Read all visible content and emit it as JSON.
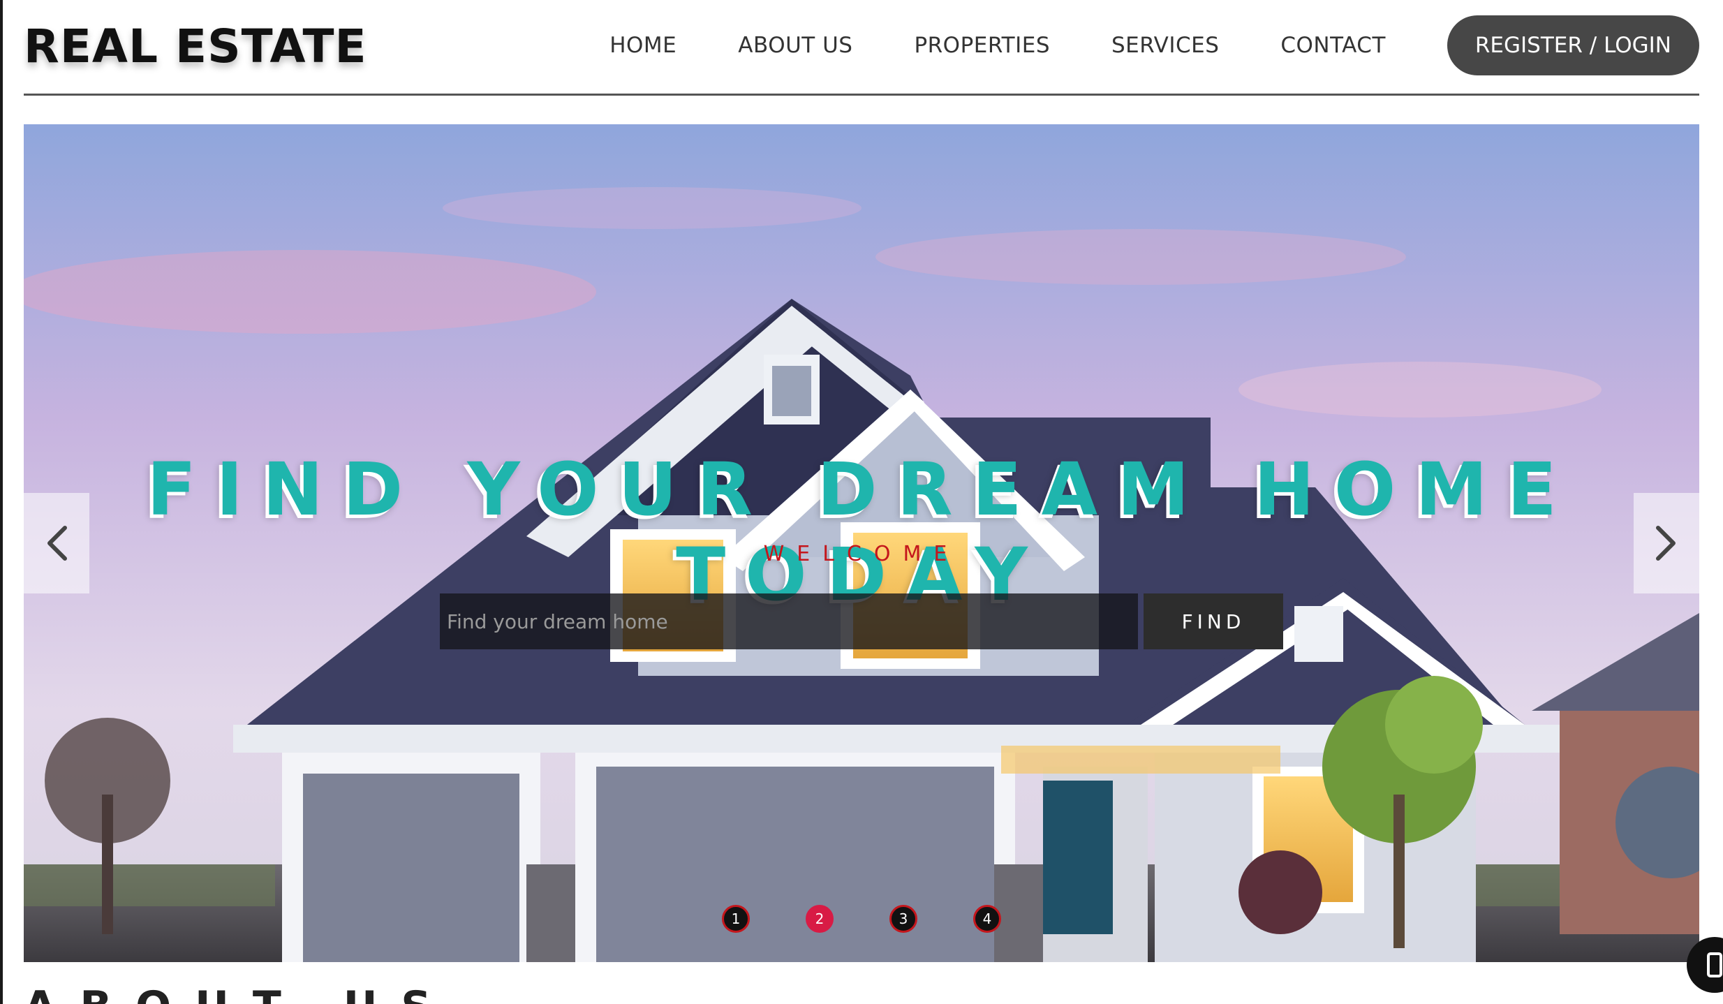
{
  "brand": {
    "name": "REAL ESTATE"
  },
  "nav": {
    "items": [
      "HOME",
      "ABOUT US",
      "PROPERTIES",
      "SERVICES",
      "CONTACT"
    ],
    "cta_label": "REGISTER / LOGIN"
  },
  "hero": {
    "headline": "FIND YOUR DREAM HOME TODAY",
    "subheadline": "WELCOME",
    "search_placeholder": "Find your dream home",
    "search_value": "",
    "find_label": "FIND",
    "slide_dots": [
      "1",
      "2",
      "3",
      "4"
    ],
    "active_slide": "2"
  },
  "next_section": {
    "title_peek": "ABOUT US"
  },
  "colors": {
    "headline": "#1fb5ad",
    "subheadline": "#c4161c",
    "cta_bg": "#474747",
    "dot_active": "#d81b45"
  },
  "icons": {
    "prev": "chevron-left-icon",
    "next": "chevron-right-icon",
    "float": "mobile-icon"
  }
}
